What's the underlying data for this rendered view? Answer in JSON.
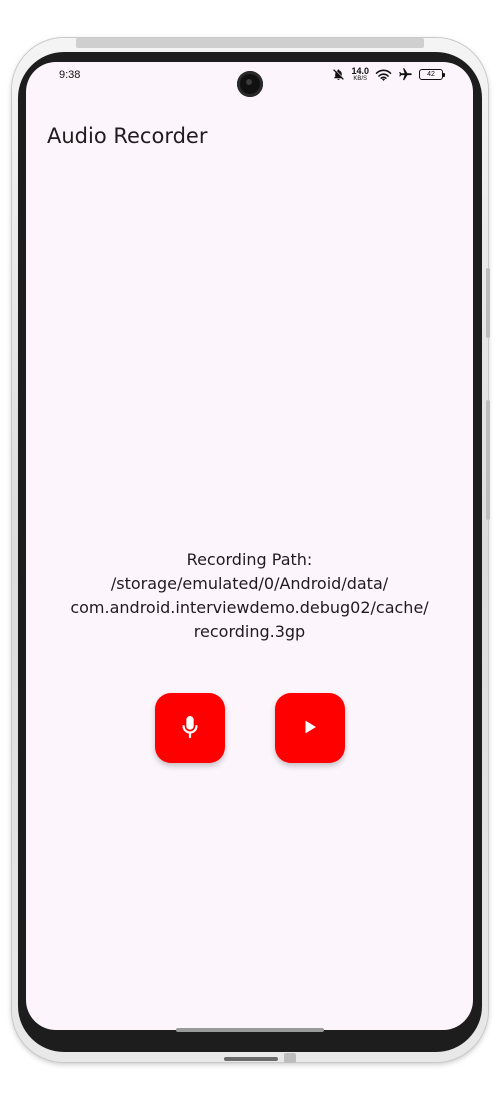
{
  "status_bar": {
    "time": "9:38",
    "net_speed_value": "14.0",
    "net_speed_unit": "KB/S",
    "battery_level": "42",
    "icons": [
      "notifications-off-icon",
      "wifi-icon",
      "airplane-icon",
      "battery-icon"
    ]
  },
  "app_bar": {
    "title": "Audio Recorder"
  },
  "recording": {
    "label": "Recording Path:",
    "path_lines": [
      "/storage/emulated/0/Android/data/",
      "com.android.interviewdemo.debug02/cache/",
      "recording.3gp"
    ]
  },
  "controls": {
    "record_icon": "mic-icon",
    "play_icon": "play-icon",
    "accent_color": "#ff0000"
  },
  "colors": {
    "screen_background": "#fcf5fb",
    "text": "#1f1b1f"
  }
}
